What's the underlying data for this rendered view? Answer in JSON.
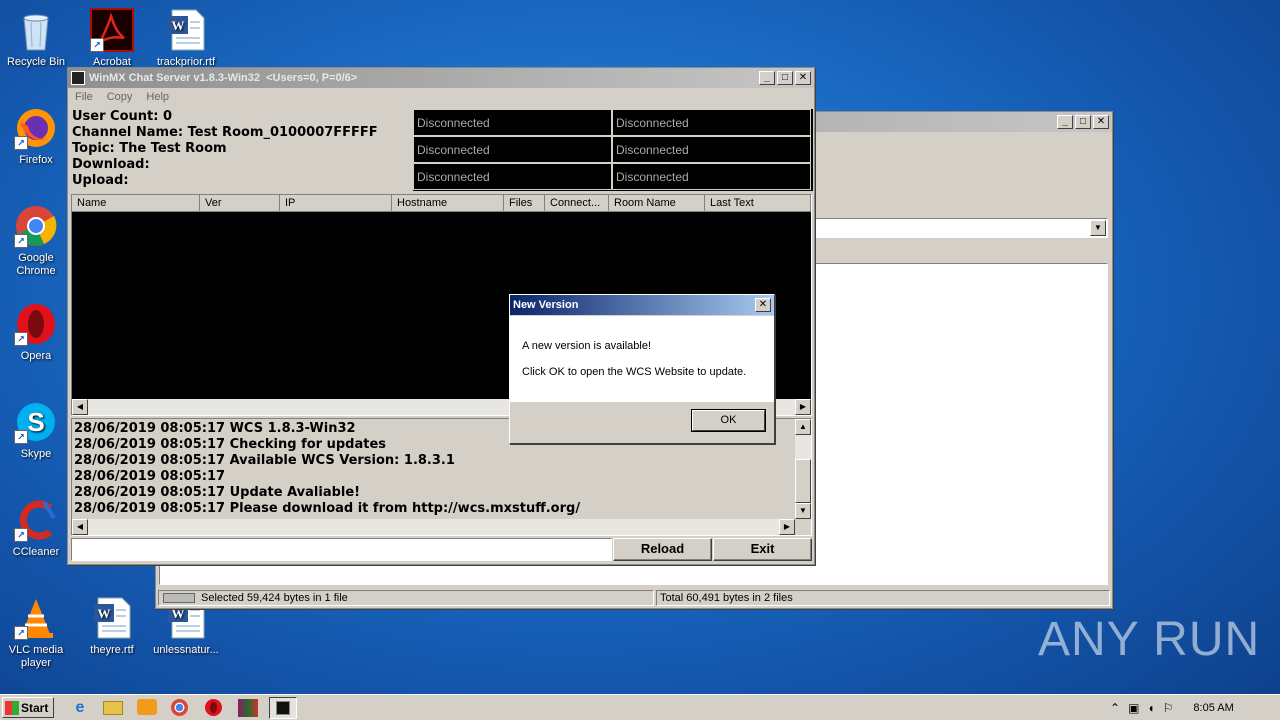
{
  "desktop": {
    "icons": [
      {
        "label": "Recycle Bin"
      },
      {
        "label": "Acrobat"
      },
      {
        "label": "trackprior.rtf"
      },
      {
        "label": "Firefox"
      },
      {
        "label": "Google Chrome"
      },
      {
        "label": "Opera"
      },
      {
        "label": "Skype"
      },
      {
        "label": "CCleaner"
      },
      {
        "label": "VLC media player"
      },
      {
        "label": "theyre.rtf"
      },
      {
        "label": "unlessnatur..."
      }
    ],
    "watermark": "ANY RUN"
  },
  "background_window": {
    "status_left": "Selected 59,424 bytes in 1 file",
    "status_right": "Total 60,491 bytes in 2 files"
  },
  "main_window": {
    "title": "WinMX Chat Server v1.8.3-Win32  <Users=0, P=0/6>",
    "menu": [
      "File",
      "Copy",
      "Help"
    ],
    "info": {
      "user_count": "User Count: 0",
      "channel_name": "Channel Name: Test Room_0100007FFFFF",
      "topic": "Topic: The Test Room",
      "download": "Download:",
      "upload": "Upload:"
    },
    "status_grid": [
      "Disconnected",
      "Disconnected",
      "Disconnected",
      "Disconnected",
      "Disconnected",
      "Disconnected"
    ],
    "columns": [
      "Name",
      "Ver",
      "IP",
      "Hostname",
      "Files",
      "Connect...",
      "Room Name",
      "Last Text"
    ],
    "log": [
      "28/06/2019 08:05:17 WCS 1.8.3-Win32",
      "28/06/2019 08:05:17 Checking for updates",
      "28/06/2019 08:05:17 Available WCS Version: 1.8.3.1",
      "28/06/2019 08:05:17",
      "28/06/2019 08:05:17 Update Avaliable!",
      "28/06/2019 08:05:17 Please download it from http://wcs.mxstuff.org/"
    ],
    "input_value": "",
    "reload_label": "Reload",
    "exit_label": "Exit"
  },
  "dialog": {
    "title": "New Version",
    "line1": "A new version is available!",
    "line2": "Click OK to open the WCS Website to update.",
    "ok_label": "OK"
  },
  "taskbar": {
    "start_label": "Start",
    "clock": "8:05 AM"
  },
  "colors": {
    "desktop": "#1c6fc9",
    "window_face": "#d4d0c8",
    "title_active": "#0a246a",
    "status_text": "#aaaaaa"
  }
}
